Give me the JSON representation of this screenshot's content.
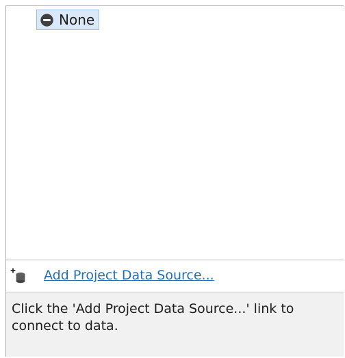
{
  "tree": {
    "items": [
      {
        "label": "None",
        "icon": "none-circle-icon",
        "selected": true
      }
    ]
  },
  "actions": {
    "add_project_data_source": "Add Project Data Source...",
    "add_icon": "add-database-icon"
  },
  "help": {
    "text": "Click the 'Add Project Data Source...' link to connect to data."
  },
  "colors": {
    "selection_background": "#dbe8f7",
    "selection_border": "#9fbfe3",
    "link": "#1f6fb6",
    "help_background": "#f1f1f1"
  }
}
